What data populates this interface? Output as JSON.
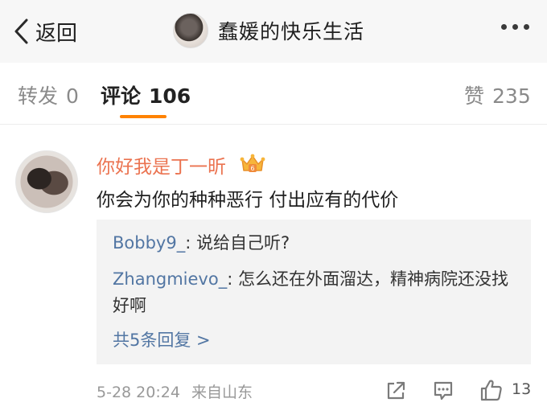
{
  "header": {
    "back_label": "返回",
    "title": "蠢媛的快乐生活"
  },
  "tabs": {
    "repost_label": "转发",
    "repost_count": "0",
    "comment_label": "评论",
    "comment_count": "106",
    "like_label": "赞",
    "like_count": "235"
  },
  "comment": {
    "username": "你好我是丁一昕",
    "text": "你会为你的种种恶行 付出应有的代价",
    "replies": [
      {
        "user": "Bobby9_",
        "text": ": 说给自己听?"
      },
      {
        "user": "Zhangmievo_",
        "text": ": 怎么还在外面溜达，精神病院还没找好啊"
      }
    ],
    "more_replies": "共5条回复 >",
    "time": "5-28 20:24",
    "location": "来自山东",
    "like_count": "13"
  },
  "colors": {
    "accent": "#ff8200",
    "username": "#eb7350",
    "link": "#5276a3"
  }
}
